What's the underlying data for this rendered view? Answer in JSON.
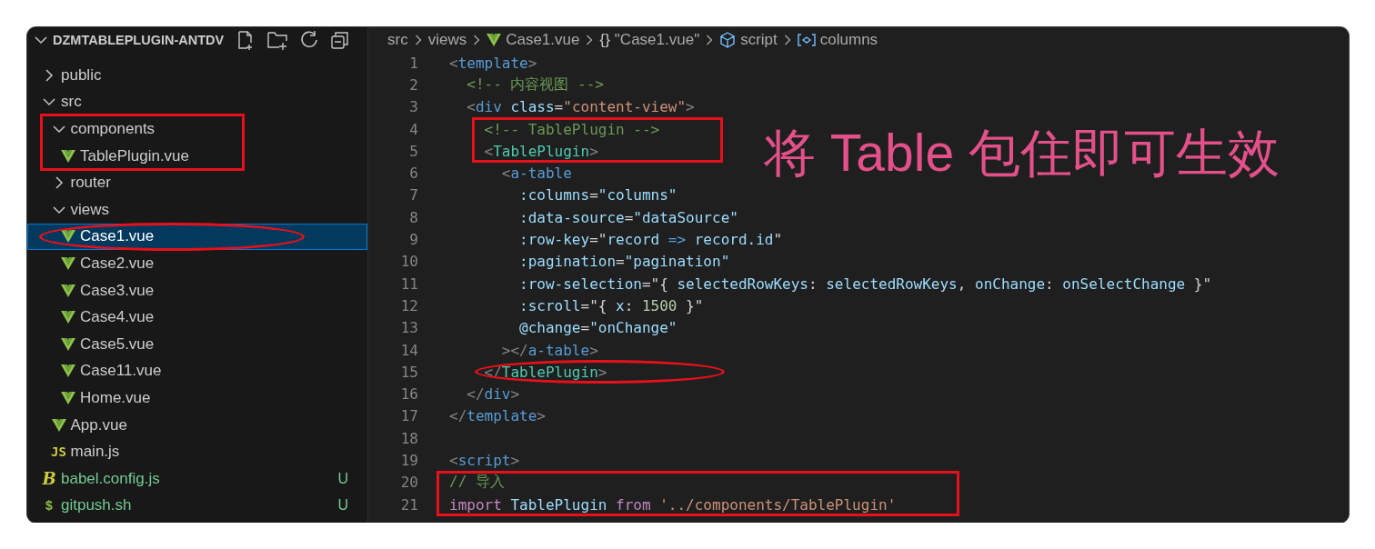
{
  "explorer": {
    "title": "DZMTABLEPLUGIN-ANTDV",
    "tree": [
      {
        "label": "public",
        "kind": "folder",
        "expanded": false,
        "selected": false
      },
      {
        "label": "src",
        "kind": "folder",
        "expanded": true,
        "selected": false,
        "children": [
          {
            "label": "components",
            "kind": "folder",
            "expanded": true,
            "selected": false,
            "boxed": true,
            "children": [
              {
                "label": "TablePlugin.vue",
                "kind": "vue",
                "selected": false,
                "boxed": true
              }
            ]
          },
          {
            "label": "router",
            "kind": "folder",
            "expanded": false,
            "selected": false
          },
          {
            "label": "views",
            "kind": "folder",
            "expanded": true,
            "selected": false,
            "children": [
              {
                "label": "Case1.vue",
                "kind": "vue",
                "selected": true,
                "circled": true
              },
              {
                "label": "Case2.vue",
                "kind": "vue",
                "selected": false
              },
              {
                "label": "Case3.vue",
                "kind": "vue",
                "selected": false
              },
              {
                "label": "Case4.vue",
                "kind": "vue",
                "selected": false
              },
              {
                "label": "Case5.vue",
                "kind": "vue",
                "selected": false
              },
              {
                "label": "Case11.vue",
                "kind": "vue",
                "selected": false
              },
              {
                "label": "Home.vue",
                "kind": "vue",
                "selected": false
              }
            ]
          },
          {
            "label": "App.vue",
            "kind": "vue",
            "selected": false
          },
          {
            "label": "main.js",
            "kind": "js",
            "icon_text": "JS",
            "selected": false
          }
        ]
      },
      {
        "label": "babel.config.js",
        "kind": "babel",
        "icon_text": "B",
        "selected": false,
        "git": "U"
      },
      {
        "label": "gitpush.sh",
        "kind": "shell",
        "icon_text": "$",
        "selected": false,
        "git": "U"
      }
    ]
  },
  "breadcrumb": [
    {
      "label": "src",
      "kind": "folder"
    },
    {
      "label": "views",
      "kind": "folder"
    },
    {
      "label": "Case1.vue",
      "kind": "vue"
    },
    {
      "label": "\"Case1.vue\"",
      "kind": "braces",
      "icon_text": "{}"
    },
    {
      "label": "script",
      "kind": "module"
    },
    {
      "label": "columns",
      "kind": "variable"
    }
  ],
  "code": [
    {
      "n": "1",
      "tokens": [
        {
          "text": "<",
          "kind": "punct"
        },
        {
          "text": "template",
          "kind": "tag"
        },
        {
          "text": ">",
          "kind": "punct"
        }
      ]
    },
    {
      "n": "2",
      "tokens": [
        {
          "text": "  <!-- 内容视图 -->",
          "kind": "comment"
        }
      ]
    },
    {
      "n": "3",
      "tokens": [
        {
          "text": "  <",
          "kind": "punct"
        },
        {
          "text": "div",
          "kind": "tag"
        },
        {
          "text": " class",
          "kind": "attr"
        },
        {
          "text": "=",
          "kind": "plain"
        },
        {
          "text": "\"content-view\"",
          "kind": "string"
        },
        {
          "text": ">",
          "kind": "punct"
        }
      ]
    },
    {
      "n": "4",
      "boxed": true,
      "tokens": [
        {
          "text": "    <!-- TablePlugin -->",
          "kind": "comment"
        }
      ]
    },
    {
      "n": "5",
      "boxed": true,
      "tokens": [
        {
          "text": "    <",
          "kind": "punct"
        },
        {
          "text": "TablePlugin",
          "kind": "component"
        },
        {
          "text": ">",
          "kind": "punct"
        }
      ]
    },
    {
      "n": "6",
      "tokens": [
        {
          "text": "      <",
          "kind": "punct"
        },
        {
          "text": "a-table",
          "kind": "tag"
        }
      ]
    },
    {
      "n": "7",
      "tokens": [
        {
          "text": "        :columns",
          "kind": "attr"
        },
        {
          "text": "=",
          "kind": "plain"
        },
        {
          "text": "\"columns\"",
          "kind": "variable"
        }
      ]
    },
    {
      "n": "8",
      "tokens": [
        {
          "text": "        :data-source",
          "kind": "attr"
        },
        {
          "text": "=",
          "kind": "plain"
        },
        {
          "text": "\"dataSource\"",
          "kind": "variable"
        }
      ]
    },
    {
      "n": "9",
      "tokens": [
        {
          "text": "        :row-key",
          "kind": "attr"
        },
        {
          "text": "=\"",
          "kind": "plain"
        },
        {
          "text": "record",
          "kind": "variable"
        },
        {
          "text": " =>",
          "kind": "operator"
        },
        {
          "text": " record.id",
          "kind": "variable"
        },
        {
          "text": "\"",
          "kind": "plain"
        }
      ]
    },
    {
      "n": "10",
      "tokens": [
        {
          "text": "        :pagination",
          "kind": "attr"
        },
        {
          "text": "=",
          "kind": "plain"
        },
        {
          "text": "\"pagination\"",
          "kind": "variable"
        }
      ]
    },
    {
      "n": "11",
      "tokens": [
        {
          "text": "        :row-selection",
          "kind": "attr"
        },
        {
          "text": "=\"{",
          "kind": "plain"
        },
        {
          "text": " selectedRowKeys",
          "kind": "variable"
        },
        {
          "text": ":",
          "kind": "plain"
        },
        {
          "text": " selectedRowKeys",
          "kind": "variable"
        },
        {
          "text": ",",
          "kind": "plain"
        },
        {
          "text": " onChange",
          "kind": "variable"
        },
        {
          "text": ":",
          "kind": "plain"
        },
        {
          "text": " onSelectChange",
          "kind": "variable"
        },
        {
          "text": " }\"",
          "kind": "plain"
        }
      ]
    },
    {
      "n": "12",
      "tokens": [
        {
          "text": "        :scroll",
          "kind": "attr"
        },
        {
          "text": "=\"{",
          "kind": "plain"
        },
        {
          "text": " x",
          "kind": "variable"
        },
        {
          "text": ":",
          "kind": "plain"
        },
        {
          "text": " 1500",
          "kind": "number"
        },
        {
          "text": " }\"",
          "kind": "plain"
        }
      ]
    },
    {
      "n": "13",
      "tokens": [
        {
          "text": "        @change",
          "kind": "attr"
        },
        {
          "text": "=",
          "kind": "plain"
        },
        {
          "text": "\"onChange\"",
          "kind": "variable"
        }
      ]
    },
    {
      "n": "14",
      "tokens": [
        {
          "text": "      ></",
          "kind": "punct"
        },
        {
          "text": "a-table",
          "kind": "tag"
        },
        {
          "text": ">",
          "kind": "punct"
        }
      ]
    },
    {
      "n": "15",
      "circled": true,
      "tokens": [
        {
          "text": "    </",
          "kind": "punct"
        },
        {
          "text": "TablePlugin",
          "kind": "component"
        },
        {
          "text": ">",
          "kind": "punct"
        }
      ]
    },
    {
      "n": "16",
      "tokens": [
        {
          "text": "  </",
          "kind": "punct"
        },
        {
          "text": "div",
          "kind": "tag"
        },
        {
          "text": ">",
          "kind": "punct"
        }
      ]
    },
    {
      "n": "17",
      "tokens": [
        {
          "text": "</",
          "kind": "punct"
        },
        {
          "text": "template",
          "kind": "tag"
        },
        {
          "text": ">",
          "kind": "punct"
        }
      ]
    },
    {
      "n": "18"
    },
    {
      "n": "19",
      "tokens": [
        {
          "text": "<",
          "kind": "punct"
        },
        {
          "text": "script",
          "kind": "tag"
        },
        {
          "text": ">",
          "kind": "punct"
        }
      ]
    },
    {
      "n": "20",
      "boxed": true,
      "tokens": [
        {
          "text": "// 导入",
          "kind": "comment"
        }
      ]
    },
    {
      "n": "21",
      "boxed": true,
      "tokens": [
        {
          "text": "import",
          "kind": "keyword"
        },
        {
          "text": " TablePlugin",
          "kind": "variable"
        },
        {
          "text": " from",
          "kind": "keyword"
        },
        {
          "text": " '../components/TablePlugin'",
          "kind": "string"
        }
      ]
    }
  ],
  "caption": "将 Table 包住即可生效"
}
